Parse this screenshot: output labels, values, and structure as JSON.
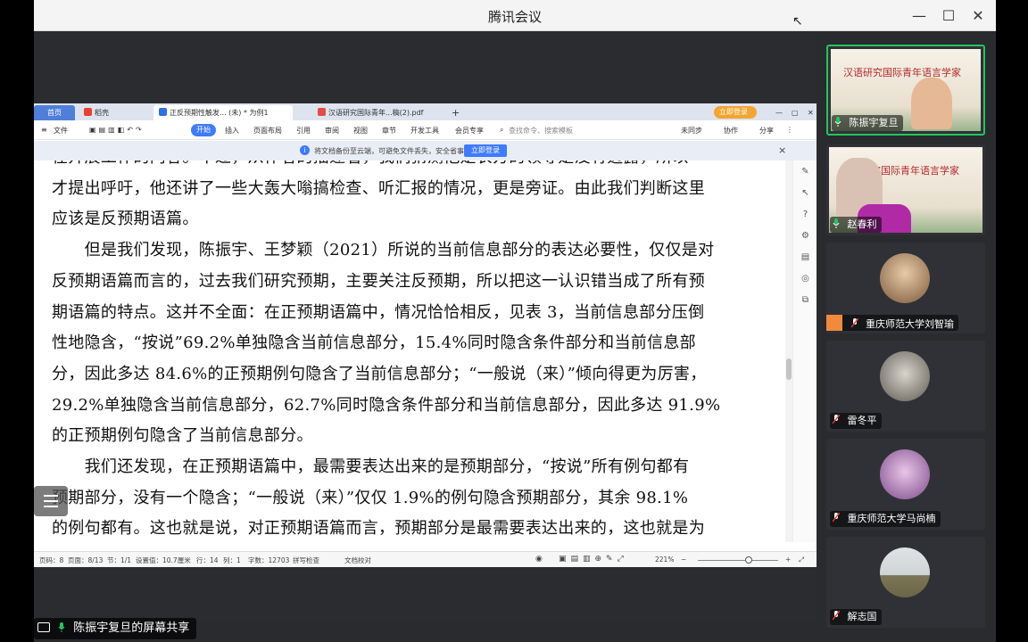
{
  "app": {
    "title": "腾讯会议",
    "share_label": "陈振宇复旦的屏幕共享"
  },
  "wps": {
    "tabs": [
      {
        "label": "首页"
      },
      {
        "label": "稻壳"
      },
      {
        "label": "正反预期性触发... (未) * 为例1"
      },
      {
        "label": "汉语研究国际青年...稿(2).pdf"
      }
    ],
    "plus": "+",
    "login_btn": "立即登录",
    "ribbon": {
      "file": "文件",
      "start": "开始",
      "items": [
        "插入",
        "页面布局",
        "引用",
        "审阅",
        "视图",
        "章节",
        "开发工具",
        "会员专享"
      ],
      "search": "查找命令、搜索模板",
      "unsync": "未同步",
      "collab": "协作",
      "share": "分享"
    },
    "notice": {
      "text": "将文档备份至云端，可避免文件丢失，安全省事",
      "button": "立即登录",
      "close": "×"
    },
    "doc_lines": [
      "在开展工作的内容。不过，从作者的描述看，我们猜测他是农方的领导是没有透露，所以",
      "才提出呼吁，他还讲了一些大轰大嗡搞检查、听汇报的情况，更是旁证。由此我们判断这里",
      "应该是反预期语篇。",
      "　　但是我们发现，陈振宇、王梦颖（2021）所说的当前信息部分的表达必要性，仅仅是对",
      "反预期语篇而言的，过去我们研究预期，主要关注反预期，所以把这一认识错当成了所有预",
      "期语篇的特点。这并不全面：在正预期语篇中，情况恰恰相反，见表 3，当前信息部分压倒",
      "性地隐含，“按说”69.2%单独隐含当前信息部分，15.4%同时隐含条件部分和当前信息部",
      "分，因此多达 84.6%的正预期例句隐含了当前信息部分；“一般说（来）”倾向得更为厉害，",
      "29.2%单独隐含当前信息部分，62.7%同时隐含条件部分和当前信息部分，因此多达 91.9%",
      "的正预期例句隐含了当前信息部分。",
      "　　我们还发现，在正预期语篇中，最需要表达出来的是预期部分，“按说”所有例句都有",
      "预期部分，没有一个隐含；“一般说（来）”仅仅 1.9%的例句隐含预期部分，其余 98.1%",
      "的例句都有。这也就是说，对正预期语篇而言，预期部分是最需要表达出来的，这也就是为"
    ],
    "status": {
      "page_num": "页码：8",
      "page": "页面：8/13",
      "section": "节：1/1",
      "setting": "设置值：10.7厘米",
      "row": "行：14",
      "col": "列：1",
      "words": "字数：12703",
      "spell": "拼写检查",
      "proof": "文档校对",
      "zoom": "221%",
      "minus": "−",
      "plus": "+"
    }
  },
  "participants": [
    {
      "name": "陈振宇复旦",
      "poster_text": "汉语研究国际青年语言学家"
    },
    {
      "name": "赵春利",
      "poster_text": "汉语研究国际青年语言学家"
    },
    {
      "name": "重庆师范大学刘智瑜"
    },
    {
      "name": "雷冬平"
    },
    {
      "name": "重庆师范大学马尚楠"
    },
    {
      "name": "解志国"
    }
  ],
  "colors": {
    "accent": "#3d7bff",
    "speaking": "#22c55e",
    "mic_on": "#22c55e",
    "mic_muted": "#ffffff",
    "poster_red": "#b2282b"
  }
}
